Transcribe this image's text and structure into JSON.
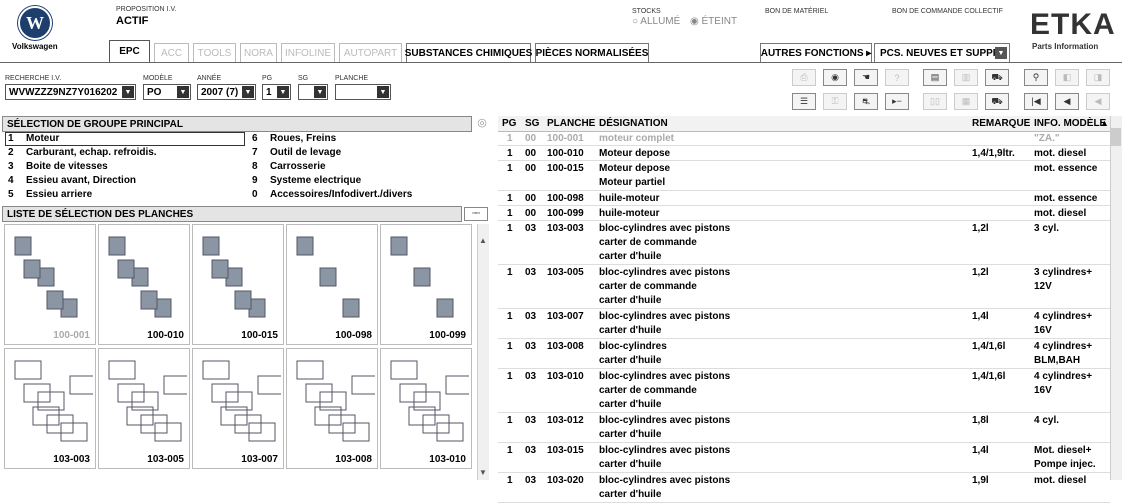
{
  "brand": {
    "vw_name": "Volkswagen",
    "etka": "ETKA",
    "etka_sub": "Parts Information"
  },
  "header": {
    "proposition_label": "PROPOSITION I.V.",
    "proposition_value": "ACTIF",
    "stocks_label": "STOCKS",
    "stocks_on": "ALLUMÉ",
    "stocks_off": "ÉTEINT",
    "bon_materiel": "BON DE MATÉRIEL",
    "bon_commande": "BON DE COMMANDE COLLECTIF"
  },
  "tabs": [
    "EPC",
    "ACC",
    "TOOLS",
    "NORA",
    "INFOLINE",
    "AUTOPART",
    "SUBSTANCES CHIMIQUES",
    "PIÈCES NORMALISÉES"
  ],
  "autres": "AUTRES FONCTIONS ▸",
  "autres_select": "PCS. NEUVES ET SUPPR.",
  "search": {
    "vin_label": "RECHERCHE I.V.",
    "vin": "WVWZZZ9NZ7Y016202",
    "modele_label": "MODÈLE",
    "modele": "PO",
    "annee_label": "ANNÉE",
    "annee": "2007 (7)",
    "pg_label": "PG",
    "pg": "1",
    "sg_label": "SG",
    "sg": "",
    "planche_label": "PLANCHE",
    "planche": ""
  },
  "groups_title": "SÉLECTION DE GROUPE PRINCIPAL",
  "groups_left": [
    {
      "n": "1",
      "t": "Moteur"
    },
    {
      "n": "2",
      "t": "Carburant, echap. refroidis."
    },
    {
      "n": "3",
      "t": "Boite de vitesses"
    },
    {
      "n": "4",
      "t": "Essieu avant, Direction"
    },
    {
      "n": "5",
      "t": "Essieu arriere"
    }
  ],
  "groups_right": [
    {
      "n": "6",
      "t": "Roues, Freins"
    },
    {
      "n": "7",
      "t": "Outil de levage"
    },
    {
      "n": "8",
      "t": "Carrosserie"
    },
    {
      "n": "9",
      "t": "Systeme electrique"
    },
    {
      "n": "0",
      "t": "Accessoires/Infodivert./divers"
    }
  ],
  "planches_title": "LISTE DE SÉLECTION DES PLANCHES",
  "thumbs": [
    "100-001",
    "100-010",
    "100-015",
    "100-098",
    "100-099",
    "103-003",
    "103-005",
    "103-007",
    "103-008",
    "103-010"
  ],
  "table": {
    "headers": [
      "PG",
      "SG",
      "PLANCHE",
      "DÉSIGNATION",
      "REMARQUE",
      "INFO. MODÈLE"
    ],
    "rows": [
      {
        "pg": "1",
        "sg": "00",
        "pl": "100-001",
        "d": [
          "moteur complet"
        ],
        "r": "",
        "i": [
          "\"ZA.\""
        ],
        "dim": true
      },
      {
        "pg": "1",
        "sg": "00",
        "pl": "100-010",
        "d": [
          "Moteur depose"
        ],
        "r": "1,4/1,9ltr.",
        "i": [
          "mot. diesel"
        ]
      },
      {
        "pg": "1",
        "sg": "00",
        "pl": "100-015",
        "d": [
          "Moteur depose",
          "Moteur partiel"
        ],
        "r": "",
        "i": [
          "mot. essence"
        ]
      },
      {
        "pg": "1",
        "sg": "00",
        "pl": "100-098",
        "d": [
          "huile-moteur"
        ],
        "r": "",
        "i": [
          "mot. essence"
        ]
      },
      {
        "pg": "1",
        "sg": "00",
        "pl": "100-099",
        "d": [
          "huile-moteur"
        ],
        "r": "",
        "i": [
          "mot. diesel"
        ]
      },
      {
        "pg": "1",
        "sg": "03",
        "pl": "103-003",
        "d": [
          "bloc-cylindres avec pistons",
          "carter de commande",
          "carter d'huile"
        ],
        "r": "1,2l",
        "i": [
          "3 cyl."
        ]
      },
      {
        "pg": "1",
        "sg": "03",
        "pl": "103-005",
        "d": [
          "bloc-cylindres avec pistons",
          "carter de commande",
          "carter d'huile"
        ],
        "r": "1,2l",
        "i": [
          "3 cylindres+",
          "12V"
        ]
      },
      {
        "pg": "1",
        "sg": "03",
        "pl": "103-007",
        "d": [
          "bloc-cylindres avec pistons",
          "carter d'huile"
        ],
        "r": "1,4l",
        "i": [
          "4 cylindres+",
          "16V"
        ]
      },
      {
        "pg": "1",
        "sg": "03",
        "pl": "103-008",
        "d": [
          "bloc-cylindres",
          "carter d'huile"
        ],
        "r": "1,4/1,6l",
        "i": [
          "4 cylindres+",
          "BLM,BAH"
        ]
      },
      {
        "pg": "1",
        "sg": "03",
        "pl": "103-010",
        "d": [
          "bloc-cylindres avec pistons",
          "carter de commande",
          "carter d'huile"
        ],
        "r": "1,4/1,6l",
        "i": [
          "4 cylindres+",
          "16V"
        ]
      },
      {
        "pg": "1",
        "sg": "03",
        "pl": "103-012",
        "d": [
          "bloc-cylindres avec pistons",
          "carter d'huile"
        ],
        "r": "1,8l",
        "i": [
          "4 cyl."
        ]
      },
      {
        "pg": "1",
        "sg": "03",
        "pl": "103-015",
        "d": [
          "bloc-cylindres avec pistons",
          "carter d'huile"
        ],
        "r": "1,4l",
        "i": [
          "Mot. diesel+",
          "Pompe injec."
        ]
      },
      {
        "pg": "1",
        "sg": "03",
        "pl": "103-020",
        "d": [
          "bloc-cylindres avec pistons",
          "carter d'huile"
        ],
        "r": "1,9l",
        "i": [
          "mot. diesel"
        ]
      }
    ]
  }
}
